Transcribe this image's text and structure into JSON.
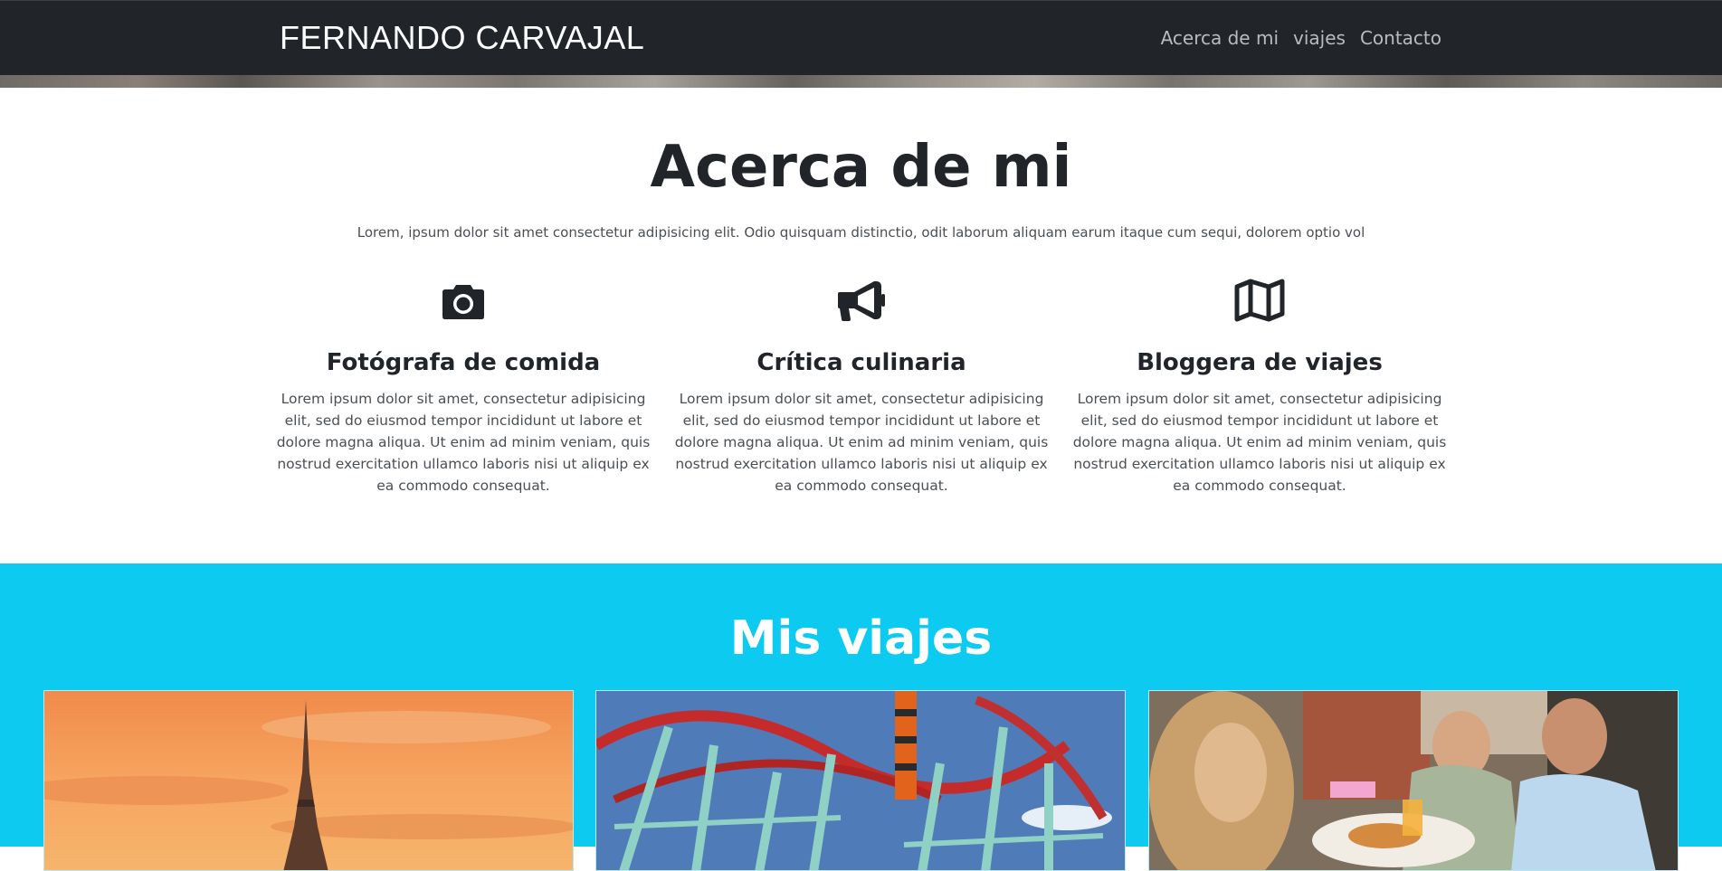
{
  "navbar": {
    "brand": "FERNANDO CARVAJAL",
    "links": [
      "Acerca de mi",
      "viajes",
      "Contacto"
    ]
  },
  "about": {
    "title": "Acerca de mi",
    "intro": "Lorem, ipsum dolor sit amet consectetur adipisicing elit. Odio quisquam distinctio, odit laborum aliquam earum itaque cum sequi, dolorem optio vol",
    "features": [
      {
        "icon": "camera-icon",
        "title": "Fotógrafa de comida",
        "text": "Lorem ipsum dolor sit amet, consectetur adipisicing elit, sed do eiusmod tempor incididunt ut labore et dolore magna aliqua. Ut enim ad minim veniam, quis nostrud exercitation ullamco laboris nisi ut aliquip ex ea commodo consequat."
      },
      {
        "icon": "megaphone-icon",
        "title": "Crítica culinaria",
        "text": "Lorem ipsum dolor sit amet, consectetur adipisicing elit, sed do eiusmod tempor incididunt ut labore et dolore magna aliqua. Ut enim ad minim veniam, quis nostrud exercitation ullamco laboris nisi ut aliquip ex ea commodo consequat."
      },
      {
        "icon": "map-icon",
        "title": "Bloggera de viajes",
        "text": "Lorem ipsum dolor sit amet, consectetur adipisicing elit, sed do eiusmod tempor incididunt ut labore et dolore magna aliqua. Ut enim ad minim veniam, quis nostrud exercitation ullamco laboris nisi ut aliquip ex ea commodo consequat."
      }
    ]
  },
  "travels": {
    "title": "Mis viajes",
    "cards": [
      {
        "image": "eiffel-tower-sunset-image"
      },
      {
        "image": "roller-coaster-image"
      },
      {
        "image": "friends-dining-image"
      }
    ]
  },
  "colors": {
    "navbar_bg": "#212529",
    "accent": "#0dcaf0",
    "text": "#212529"
  }
}
